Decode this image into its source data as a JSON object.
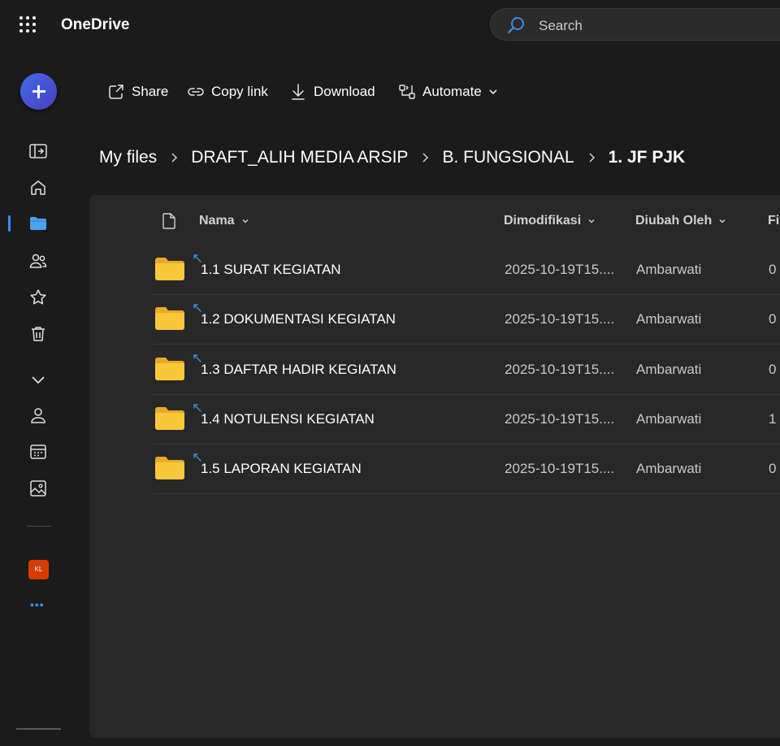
{
  "app": {
    "title": "OneDrive"
  },
  "search": {
    "placeholder": "Search"
  },
  "rail": {
    "new_button_icon": "plus-icon",
    "items": [
      {
        "icon": "panel-toggle-icon"
      },
      {
        "icon": "home-icon"
      },
      {
        "icon": "folder-icon",
        "active": true
      },
      {
        "icon": "people-icon"
      },
      {
        "icon": "star-icon"
      },
      {
        "icon": "trash-icon"
      },
      {
        "icon": "chevron-down-icon"
      },
      {
        "icon": "person-icon"
      },
      {
        "icon": "calendar-icon"
      },
      {
        "icon": "photo-icon"
      }
    ],
    "badge": "KL",
    "more": "•••"
  },
  "toolbar": {
    "share": "Share",
    "copy_link": "Copy link",
    "download": "Download",
    "automate": "Automate"
  },
  "breadcrumb": [
    "My files",
    "DRAFT_ALIH MEDIA ARSIP",
    "B. FUNGSIONAL",
    "1. JF PJK"
  ],
  "table": {
    "columns": {
      "name": "Nama",
      "modified": "Dimodifikasi",
      "modified_by": "Diubah Oleh",
      "files": "Fil"
    },
    "rows": [
      {
        "name": "1.1 SURAT KEGIATAN",
        "modified": "2025-10-19T15....",
        "modified_by": "Ambarwati",
        "files": "0"
      },
      {
        "name": "1.2 DOKUMENTASI KEGIATAN",
        "modified": "2025-10-19T15....",
        "modified_by": "Ambarwati",
        "files": "0"
      },
      {
        "name": "1.3 DAFTAR HADIR KEGIATAN",
        "modified": "2025-10-19T15....",
        "modified_by": "Ambarwati",
        "files": "0"
      },
      {
        "name": "1.4 NOTULENSI KEGIATAN",
        "modified": "2025-10-19T15....",
        "modified_by": "Ambarwati",
        "files": "1"
      },
      {
        "name": "1.5 LAPORAN KEGIATAN",
        "modified": "2025-10-19T15....",
        "modified_by": "Ambarwati",
        "files": "0"
      }
    ]
  },
  "colors": {
    "accent": "#3a8de8",
    "folder": "#f8c73a",
    "background": "#1b1b1b",
    "panel": "#282828"
  }
}
